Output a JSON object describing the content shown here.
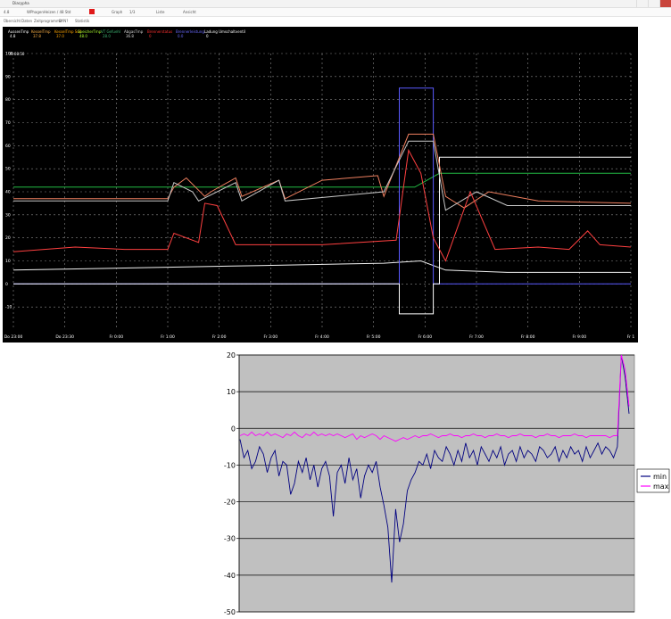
{
  "window": {
    "title": "Diacypha",
    "toolbar": [
      "4.8",
      "WPhagenHeizen / 48 Std",
      "Graph",
      "1/3",
      "Liste",
      "Ansicht"
    ],
    "menu": [
      "Übersicht",
      "Daten",
      "Zeitprogramme",
      "DYN?",
      "Statistik"
    ]
  },
  "colors": {
    "trend_bg": "#000000",
    "excel_plot_bg": "#c0c0c0",
    "min_series": "#000080",
    "max_series": "#ff00ff"
  },
  "chart_data": [
    {
      "type": "line",
      "title": "",
      "legend_position": "top",
      "legend": [
        {
          "name": "AussenTmp",
          "value": "4.8",
          "color": "#ffffff"
        },
        {
          "name": "KesselTmp",
          "value": "37.8",
          "color": "#ffb347"
        },
        {
          "name": "KesselTmp Soll",
          "value": "37.0",
          "color": "#ffa500"
        },
        {
          "name": "SpeicherTmp",
          "value": "48.0",
          "color": "#adff2f"
        },
        {
          "name": "VT Gefuehl",
          "value": "28.0",
          "color": "#3cb371"
        },
        {
          "name": "AbgasTmp",
          "value": "36.8",
          "color": "#d3d3d3"
        },
        {
          "name": "Brennerstatus",
          "value": "0",
          "color": "#ff3030"
        },
        {
          "name": "Brennerleistung",
          "value": "0.0",
          "color": "#6a6aff"
        },
        {
          "name": "Ladung Umschaltventil",
          "value": "0",
          "color": "#ffffff"
        }
      ],
      "timestamp": "Fr 08:50",
      "ylim": [
        -20,
        100
      ],
      "y_ticks": [
        "100",
        "90",
        "80",
        "70",
        "60",
        "50",
        "40",
        "30",
        "20",
        "10",
        "0",
        "-10"
      ],
      "x_ticks": [
        "Do 23:00",
        "Do 23:30",
        "Fr 0:00",
        "Fr 1:00",
        "Fr 2:00",
        "Fr 3:00",
        "Fr 4:00",
        "Fr 5:00",
        "Fr 6:00",
        "Fr 7:00",
        "Fr 8:00",
        "Fr 9:00",
        "Fr 1"
      ],
      "grid": true,
      "series": [
        {
          "name": "SpeicherTmp",
          "color": "#22bb44",
          "x": [
            0,
            0.65,
            0.69,
            1.0
          ],
          "y": [
            42,
            42,
            48,
            48
          ]
        },
        {
          "name": "AussenTmp",
          "color": "#f0f0f0",
          "x": [
            0,
            0.2,
            0.4,
            0.6,
            0.66,
            0.7,
            0.8,
            1.0
          ],
          "y": [
            6,
            7,
            8,
            9,
            10,
            6,
            5,
            5
          ]
        },
        {
          "name": "Brennerleistung",
          "color": "#5a5aff",
          "x": [
            0,
            0.625,
            0.625,
            0.68,
            0.68,
            1.0
          ],
          "y": [
            0,
            0,
            85,
            85,
            0,
            0
          ]
        },
        {
          "name": "Umschaltventil",
          "color": "#ffffff",
          "x": [
            0,
            0.625,
            0.625,
            0.68,
            0.68,
            0.69,
            0.69,
            1.0
          ],
          "y": [
            0,
            0,
            -13,
            -13,
            0,
            0,
            55,
            55
          ]
        },
        {
          "name": "KesselTmp",
          "color": "#f08060",
          "x": [
            0,
            0.25,
            0.26,
            0.28,
            0.31,
            0.32,
            0.36,
            0.37,
            0.43,
            0.44,
            0.5,
            0.59,
            0.6,
            0.64,
            0.68,
            0.7,
            0.73,
            0.77,
            0.85,
            1.0
          ],
          "y": [
            37,
            37,
            42,
            46,
            38,
            40,
            46,
            38,
            45,
            37,
            45,
            47,
            38,
            65,
            65,
            38,
            33,
            40,
            36,
            35
          ]
        },
        {
          "name": "AbgasTmp",
          "color": "#c8c8c8",
          "x": [
            0,
            0.25,
            0.26,
            0.29,
            0.3,
            0.36,
            0.37,
            0.43,
            0.44,
            0.6,
            0.64,
            0.68,
            0.7,
            0.75,
            0.8,
            1.0
          ],
          "y": [
            36,
            36,
            44,
            40,
            36,
            44,
            36,
            45,
            36,
            40,
            62,
            62,
            32,
            40,
            34,
            34
          ]
        },
        {
          "name": "VT Gefuehl",
          "color": "#ff4040",
          "x": [
            0,
            0.1,
            0.18,
            0.25,
            0.26,
            0.3,
            0.31,
            0.33,
            0.36,
            0.5,
            0.62,
            0.64,
            0.66,
            0.68,
            0.7,
            0.72,
            0.74,
            0.78,
            0.85,
            0.9,
            0.93,
            0.95,
            1.0
          ],
          "y": [
            14,
            16,
            15,
            15,
            22,
            18,
            35,
            34,
            17,
            17,
            19,
            58,
            48,
            20,
            10,
            25,
            40,
            15,
            16,
            15,
            23,
            17,
            16
          ]
        }
      ]
    },
    {
      "type": "line",
      "title": "",
      "xlabel": "",
      "ylabel": "",
      "ylim": [
        -50,
        20
      ],
      "y_ticks": [
        20,
        10,
        0,
        -10,
        -20,
        -30,
        -40,
        -50
      ],
      "legend_position": "right",
      "grid": true,
      "series": [
        {
          "name": "min",
          "color": "#000080",
          "y": [
            -3,
            -8,
            -6,
            -11,
            -9,
            -5,
            -7,
            -12,
            -8,
            -6,
            -13,
            -9,
            -10,
            -18,
            -15,
            -9,
            -12,
            -8,
            -14,
            -10,
            -16,
            -11,
            -9,
            -13,
            -24,
            -12,
            -10,
            -15,
            -8,
            -14,
            -11,
            -19,
            -13,
            -10,
            -12,
            -9,
            -16,
            -21,
            -27,
            -42,
            -22,
            -31,
            -26,
            -17,
            -14,
            -12,
            -9,
            -10,
            -7,
            -11,
            -6,
            -8,
            -9,
            -5,
            -7,
            -10,
            -6,
            -9,
            -4,
            -8,
            -6,
            -10,
            -5,
            -7,
            -9,
            -6,
            -8,
            -5,
            -10,
            -7,
            -6,
            -9,
            -5,
            -8,
            -6,
            -7,
            -9,
            -5,
            -6,
            -8,
            -7,
            -5,
            -9,
            -6,
            -8,
            -5,
            -7,
            -6,
            -9,
            -5,
            -8,
            -6,
            -4,
            -7,
            -5,
            -6,
            -8,
            -5,
            22,
            14,
            4
          ]
        },
        {
          "name": "max",
          "color": "#ff00ff",
          "y": [
            -2,
            -1.5,
            -2,
            -1,
            -2,
            -1.5,
            -2,
            -1,
            -2,
            -1.5,
            -2,
            -2.5,
            -1.5,
            -2,
            -1,
            -2,
            -2.5,
            -1.5,
            -2,
            -1,
            -2,
            -1.5,
            -2,
            -1.5,
            -2,
            -1.5,
            -2,
            -2.5,
            -2,
            -1.5,
            -3,
            -2,
            -2.5,
            -2,
            -1.5,
            -2,
            -3,
            -2,
            -2.5,
            -3,
            -3.5,
            -3,
            -2.5,
            -3,
            -2.5,
            -2,
            -2.5,
            -2,
            -2,
            -1.5,
            -2,
            -2.5,
            -2,
            -2,
            -1.5,
            -2,
            -2,
            -2.5,
            -2,
            -2,
            -1.5,
            -2,
            -2,
            -2.5,
            -2,
            -2,
            -1.5,
            -2,
            -2,
            -2.5,
            -2,
            -2,
            -1.5,
            -2,
            -2,
            -2,
            -2.5,
            -2,
            -2,
            -1.5,
            -2,
            -2,
            -2.5,
            -2,
            -2,
            -2,
            -1.5,
            -2,
            -2,
            -2.5,
            -2,
            -2,
            -2,
            -2,
            -2,
            -2.5,
            -2,
            -2,
            20,
            16,
            6
          ]
        }
      ]
    }
  ]
}
